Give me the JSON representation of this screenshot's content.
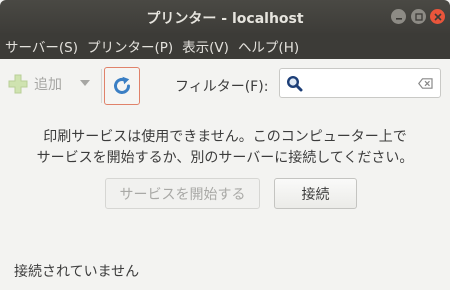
{
  "window": {
    "title": "プリンター - localhost"
  },
  "menubar": {
    "items": [
      {
        "label": "サーバー(S)"
      },
      {
        "label": "プリンター(P)"
      },
      {
        "label": "表示(V)"
      },
      {
        "label": "ヘルプ(H)"
      }
    ]
  },
  "toolbar": {
    "add_label": "追加",
    "add_icon": "plus-icon",
    "refresh_icon": "refresh-icon",
    "filter_label": "フィルター(F):",
    "filter_value": "",
    "filter_placeholder": ""
  },
  "main": {
    "message_line1": "印刷サービスは使用できません。このコンピューター上で",
    "message_line2": "サービスを開始するか、別のサーバーに接続してください。",
    "start_service_label": "サービスを開始する",
    "connect_label": "接続"
  },
  "status": {
    "text": "接続されていません"
  },
  "colors": {
    "titlebar": "#3d3c38",
    "close_button": "#e9553b",
    "refresh_focus_border": "#e0826a",
    "refresh_icon": "#3b7fc4"
  }
}
